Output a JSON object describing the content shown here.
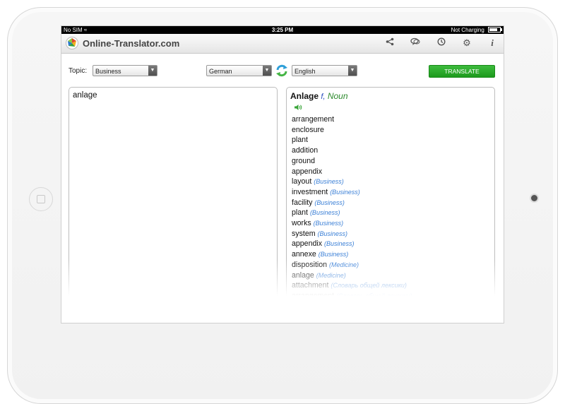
{
  "status_bar": {
    "carrier": "No SIM",
    "time": "3:25 PM",
    "power": "Not Charging"
  },
  "app": {
    "title": "Online-Translator.com"
  },
  "toolbar": {
    "icons": [
      "share-icon",
      "chat-icon",
      "history-icon",
      "settings-icon",
      "info-icon"
    ]
  },
  "controls": {
    "topic_label": "Topic:",
    "topic_value": "Business",
    "source_language": "German",
    "target_language": "English",
    "translate_label": "TRANSLATE"
  },
  "source": {
    "text": "anlage"
  },
  "result": {
    "headword": "Anlage",
    "gender": "f,",
    "pos": "Noun",
    "translations": [
      {
        "word": "arrangement",
        "tag": ""
      },
      {
        "word": "enclosure",
        "tag": ""
      },
      {
        "word": "plant",
        "tag": ""
      },
      {
        "word": "addition",
        "tag": ""
      },
      {
        "word": "ground",
        "tag": ""
      },
      {
        "word": "appendix",
        "tag": ""
      },
      {
        "word": "layout",
        "tag": "(Business)"
      },
      {
        "word": "investment",
        "tag": "(Business)"
      },
      {
        "word": "facility",
        "tag": "(Business)"
      },
      {
        "word": "plant",
        "tag": "(Business)"
      },
      {
        "word": "works",
        "tag": "(Business)"
      },
      {
        "word": "system",
        "tag": "(Business)"
      },
      {
        "word": "appendix",
        "tag": "(Business)"
      },
      {
        "word": "annexe",
        "tag": "(Business)"
      },
      {
        "word": "disposition",
        "tag": "(Medicine)"
      },
      {
        "word": "anlage",
        "tag": "(Medicine)"
      },
      {
        "word": "attachment",
        "tag": "(Словарь общей лексики)"
      },
      {
        "word": "arrangement",
        "tag": "(Словарь общей лексики)"
      }
    ]
  },
  "colors": {
    "translate_button": "#2aa82a",
    "tag_text": "#3a7fd6",
    "pos_text": "#2c8a2c"
  }
}
